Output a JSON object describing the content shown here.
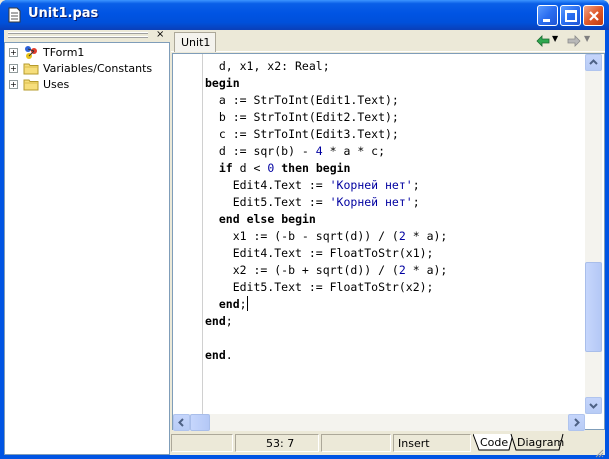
{
  "window": {
    "title": "Unit1.pas"
  },
  "explorer": {
    "close_glyph": "×",
    "items": [
      {
        "label": "TForm1",
        "icon": "form-icon"
      },
      {
        "label": "Variables/Constants",
        "icon": "folder-icon"
      },
      {
        "label": "Uses",
        "icon": "folder-icon"
      }
    ]
  },
  "editor": {
    "tab_label": "Unit1",
    "lines": [
      [
        {
          "t": "  d, x1, x2: Real;",
          "c": ""
        }
      ],
      [
        {
          "t": "begin",
          "c": "kw"
        }
      ],
      [
        {
          "t": "  a := StrToInt(Edit1.Text);",
          "c": ""
        }
      ],
      [
        {
          "t": "  b := StrToInt(Edit2.Text);",
          "c": ""
        }
      ],
      [
        {
          "t": "  c := StrToInt(Edit3.Text);",
          "c": ""
        }
      ],
      [
        {
          "t": "  d := sqr(b) - ",
          "c": ""
        },
        {
          "t": "4",
          "c": "num"
        },
        {
          "t": " * a * c;",
          "c": ""
        }
      ],
      [
        {
          "t": "  ",
          "c": ""
        },
        {
          "t": "if",
          "c": "kw"
        },
        {
          "t": " d < ",
          "c": ""
        },
        {
          "t": "0",
          "c": "num"
        },
        {
          "t": " ",
          "c": ""
        },
        {
          "t": "then",
          "c": "kw"
        },
        {
          "t": " ",
          "c": ""
        },
        {
          "t": "begin",
          "c": "kw"
        }
      ],
      [
        {
          "t": "    Edit4.Text := ",
          "c": ""
        },
        {
          "t": "'Корней нет'",
          "c": "str"
        },
        {
          "t": ";",
          "c": ""
        }
      ],
      [
        {
          "t": "    Edit5.Text := ",
          "c": ""
        },
        {
          "t": "'Корней нет'",
          "c": "str"
        },
        {
          "t": ";",
          "c": ""
        }
      ],
      [
        {
          "t": "  ",
          "c": ""
        },
        {
          "t": "end",
          "c": "kw"
        },
        {
          "t": " ",
          "c": ""
        },
        {
          "t": "else",
          "c": "kw"
        },
        {
          "t": " ",
          "c": ""
        },
        {
          "t": "begin",
          "c": "kw"
        }
      ],
      [
        {
          "t": "    x1 := (-b - sqrt(d)) / (",
          "c": ""
        },
        {
          "t": "2",
          "c": "num"
        },
        {
          "t": " * a);",
          "c": ""
        }
      ],
      [
        {
          "t": "    Edit4.Text := FloatToStr(x1);",
          "c": ""
        }
      ],
      [
        {
          "t": "    x2 := (-b + sqrt(d)) / (",
          "c": ""
        },
        {
          "t": "2",
          "c": "num"
        },
        {
          "t": " * a);",
          "c": ""
        }
      ],
      [
        {
          "t": "    Edit5.Text := FloatToStr(x2);",
          "c": ""
        }
      ],
      [
        {
          "t": "  ",
          "c": ""
        },
        {
          "t": "end",
          "c": "kw"
        },
        {
          "t": ";",
          "c": ""
        },
        {
          "t": "",
          "c": "caret"
        }
      ],
      [
        {
          "t": "end",
          "c": "kw"
        },
        {
          "t": ";",
          "c": ""
        }
      ],
      [
        {
          "t": "",
          "c": ""
        }
      ],
      [
        {
          "t": "end",
          "c": "kw"
        },
        {
          "t": ".",
          "c": ""
        }
      ]
    ]
  },
  "statusbar": {
    "cursor_pos": "53:  7",
    "mode": "Insert",
    "tab_code": "Code",
    "tab_diagram": "Diagram"
  },
  "colors": {
    "titlebar": "#0054E3",
    "string_literal": "#0000A0"
  }
}
